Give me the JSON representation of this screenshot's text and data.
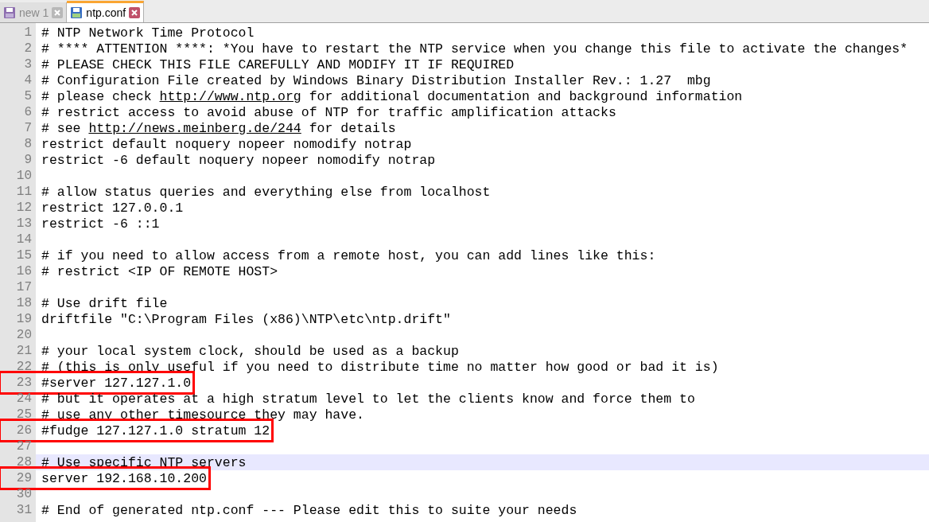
{
  "tabs": [
    {
      "label": "new 1",
      "selected": false
    },
    {
      "label": "ntp.conf",
      "selected": true
    }
  ],
  "lines": [
    {
      "number": "1",
      "segments": [
        {
          "kind": "text",
          "text": "# NTP Network Time Protocol"
        }
      ],
      "boxed": false,
      "current": false
    },
    {
      "number": "2",
      "segments": [
        {
          "kind": "text",
          "text": "# **** ATTENTION ****: *You have to restart the NTP service when you change this file to activate the changes*"
        }
      ],
      "boxed": false,
      "current": false
    },
    {
      "number": "3",
      "segments": [
        {
          "kind": "text",
          "text": "# PLEASE CHECK THIS FILE CAREFULLY AND MODIFY IT IF REQUIRED"
        }
      ],
      "boxed": false,
      "current": false
    },
    {
      "number": "4",
      "segments": [
        {
          "kind": "text",
          "text": "# Configuration File created by Windows Binary Distribution Installer Rev.: 1.27  mbg"
        }
      ],
      "boxed": false,
      "current": false
    },
    {
      "number": "5",
      "segments": [
        {
          "kind": "text",
          "text": "# please check "
        },
        {
          "kind": "link",
          "text": "http://www.ntp.org"
        },
        {
          "kind": "text",
          "text": " for additional documentation and background information"
        }
      ],
      "boxed": false,
      "current": false
    },
    {
      "number": "6",
      "segments": [
        {
          "kind": "text",
          "text": "# restrict access to avoid abuse of NTP for traffic amplification attacks"
        }
      ],
      "boxed": false,
      "current": false
    },
    {
      "number": "7",
      "segments": [
        {
          "kind": "text",
          "text": "# see "
        },
        {
          "kind": "link",
          "text": "http://news.meinberg.de/244"
        },
        {
          "kind": "text",
          "text": " for details"
        }
      ],
      "boxed": false,
      "current": false
    },
    {
      "number": "8",
      "segments": [
        {
          "kind": "text",
          "text": "restrict default noquery nopeer nomodify notrap"
        }
      ],
      "boxed": false,
      "current": false
    },
    {
      "number": "9",
      "segments": [
        {
          "kind": "text",
          "text": "restrict -6 default noquery nopeer nomodify notrap"
        }
      ],
      "boxed": false,
      "current": false
    },
    {
      "number": "10",
      "boxed": false,
      "current": false
    },
    {
      "number": "11",
      "segments": [
        {
          "kind": "text",
          "text": "# allow status queries and everything else from localhost"
        }
      ],
      "boxed": false,
      "current": false
    },
    {
      "number": "12",
      "segments": [
        {
          "kind": "text",
          "text": "restrict 127.0.0.1"
        }
      ],
      "boxed": false,
      "current": false
    },
    {
      "number": "13",
      "segments": [
        {
          "kind": "text",
          "text": "restrict -6 ::1"
        }
      ],
      "boxed": false,
      "current": false
    },
    {
      "number": "14",
      "boxed": false,
      "current": false
    },
    {
      "number": "15",
      "segments": [
        {
          "kind": "text",
          "text": "# if you need to allow access from a remote host, you can add lines like this:"
        }
      ],
      "boxed": false,
      "current": false
    },
    {
      "number": "16",
      "segments": [
        {
          "kind": "text",
          "text": "# restrict <IP OF REMOTE HOST>"
        }
      ],
      "boxed": false,
      "current": false
    },
    {
      "number": "17",
      "boxed": false,
      "current": false
    },
    {
      "number": "18",
      "segments": [
        {
          "kind": "text",
          "text": "# Use drift file"
        }
      ],
      "boxed": false,
      "current": false
    },
    {
      "number": "19",
      "segments": [
        {
          "kind": "text",
          "text": "driftfile \"C:\\Program Files (x86)\\NTP\\etc\\ntp.drift\""
        }
      ],
      "boxed": false,
      "current": false
    },
    {
      "number": "20",
      "boxed": false,
      "current": false
    },
    {
      "number": "21",
      "segments": [
        {
          "kind": "text",
          "text": "# your local system clock, should be used as a backup"
        }
      ],
      "boxed": false,
      "current": false
    },
    {
      "number": "22",
      "segments": [
        {
          "kind": "text",
          "text": "# (this is only useful if you need to distribute time no matter how good or bad it is)"
        }
      ],
      "boxed": false,
      "current": false
    },
    {
      "number": "23",
      "segments": [
        {
          "kind": "text",
          "text": "#server 127.127.1.0"
        }
      ],
      "boxed": true,
      "current": false
    },
    {
      "number": "24",
      "segments": [
        {
          "kind": "text",
          "text": "# but it operates at a high stratum level to let the clients know and force them to"
        }
      ],
      "boxed": false,
      "current": false
    },
    {
      "number": "25",
      "segments": [
        {
          "kind": "text",
          "text": "# use any other timesource they may have."
        }
      ],
      "boxed": false,
      "current": false
    },
    {
      "number": "26",
      "segments": [
        {
          "kind": "text",
          "text": "#fudge 127.127.1.0 stratum 12"
        }
      ],
      "boxed": true,
      "current": false
    },
    {
      "number": "27",
      "boxed": false,
      "current": false
    },
    {
      "number": "28",
      "segments": [
        {
          "kind": "text",
          "text": "# Use specific NTP servers"
        }
      ],
      "boxed": false,
      "current": true
    },
    {
      "number": "29",
      "segments": [
        {
          "kind": "text",
          "text": "server 192.168.10.200"
        }
      ],
      "boxed": true,
      "current": false
    },
    {
      "number": "30",
      "boxed": false,
      "current": false
    },
    {
      "number": "31",
      "segments": [
        {
          "kind": "text",
          "text": "# End of generated ntp.conf --- Please edit this to suite your needs"
        }
      ],
      "boxed": false,
      "current": false
    }
  ]
}
